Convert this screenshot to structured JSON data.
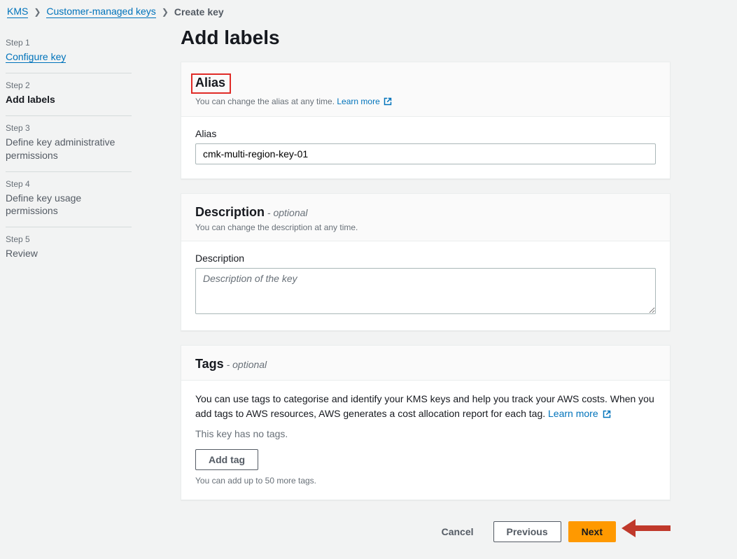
{
  "breadcrumb": {
    "root": "KMS",
    "mid": "Customer-managed keys",
    "current": "Create key"
  },
  "sidebar": {
    "steps": [
      {
        "num": "Step 1",
        "title": "Configure key",
        "link": true
      },
      {
        "num": "Step 2",
        "title": "Add labels",
        "active": true
      },
      {
        "num": "Step 3",
        "title": "Define key administrative permissions"
      },
      {
        "num": "Step 4",
        "title": "Define key usage permissions"
      },
      {
        "num": "Step 5",
        "title": "Review"
      }
    ]
  },
  "page": {
    "title": "Add labels"
  },
  "alias": {
    "heading": "Alias",
    "sub": "You can change the alias at any time.",
    "learn_more": "Learn more",
    "field_label": "Alias",
    "value": "cmk-multi-region-key-01"
  },
  "description": {
    "heading": "Description",
    "optional": "- optional",
    "sub": "You can change the description at any time.",
    "field_label": "Description",
    "placeholder": "Description of the key"
  },
  "tags": {
    "heading": "Tags",
    "optional": "- optional",
    "intro": "You can use tags to categorise and identify your KMS keys and help you track your AWS costs. When you add tags to AWS resources, AWS generates a cost allocation report for each tag.",
    "learn_more": "Learn more",
    "no_tags": "This key has no tags.",
    "add_tag_button": "Add tag",
    "hint": "You can add up to 50 more tags."
  },
  "footer": {
    "cancel": "Cancel",
    "previous": "Previous",
    "next": "Next"
  }
}
